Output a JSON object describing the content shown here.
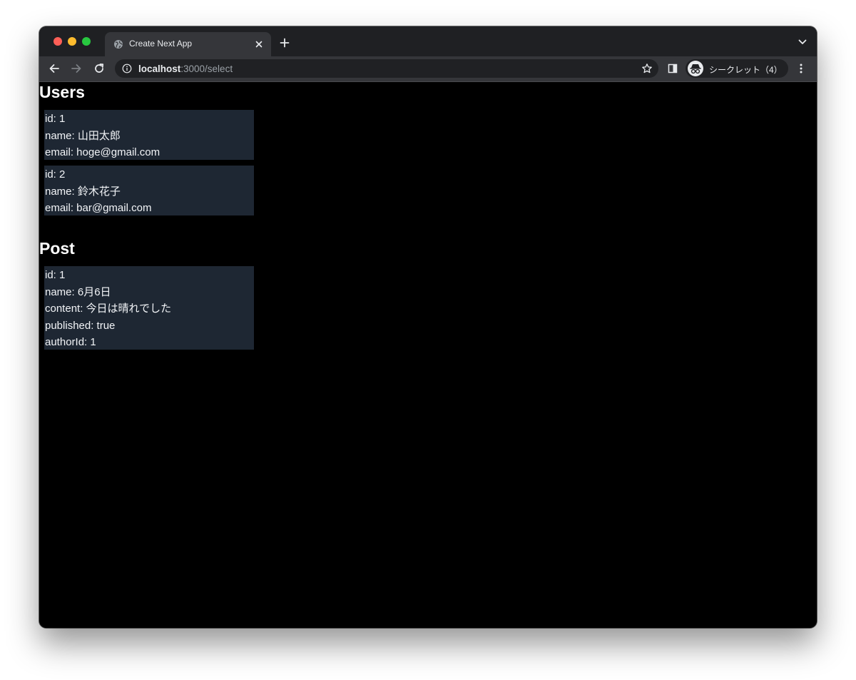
{
  "browser": {
    "tab_title": "Create Next App",
    "url_host": "localhost",
    "url_path": ":3000/select",
    "profile_label": "シークレット（4）"
  },
  "users": {
    "heading": "Users",
    "items": [
      {
        "id": "id: 1",
        "name": "name: 山田太郎",
        "email": "email: hoge@gmail.com"
      },
      {
        "id": "id: 2",
        "name": "name: 鈴木花子",
        "email": "email: bar@gmail.com"
      }
    ]
  },
  "posts": {
    "heading": "Post",
    "items": [
      {
        "id": "id: 1",
        "name": "name: 6月6日",
        "content": "content: 今日は晴れでした",
        "published": "published: true",
        "authorId": "authorId: 1"
      }
    ]
  },
  "colors": {
    "page_background": "#000000",
    "card_background": "#1e2733",
    "text": "#ffffff",
    "chrome_tabbar": "#1f2023",
    "chrome_toolbar": "#35363a"
  },
  "icons": [
    "globe-icon",
    "close-icon",
    "plus-icon",
    "chevron-down-icon",
    "back-arrow-icon",
    "forward-arrow-icon",
    "reload-icon",
    "info-icon",
    "star-icon",
    "side-panel-icon",
    "incognito-icon",
    "kebab-menu-icon"
  ]
}
